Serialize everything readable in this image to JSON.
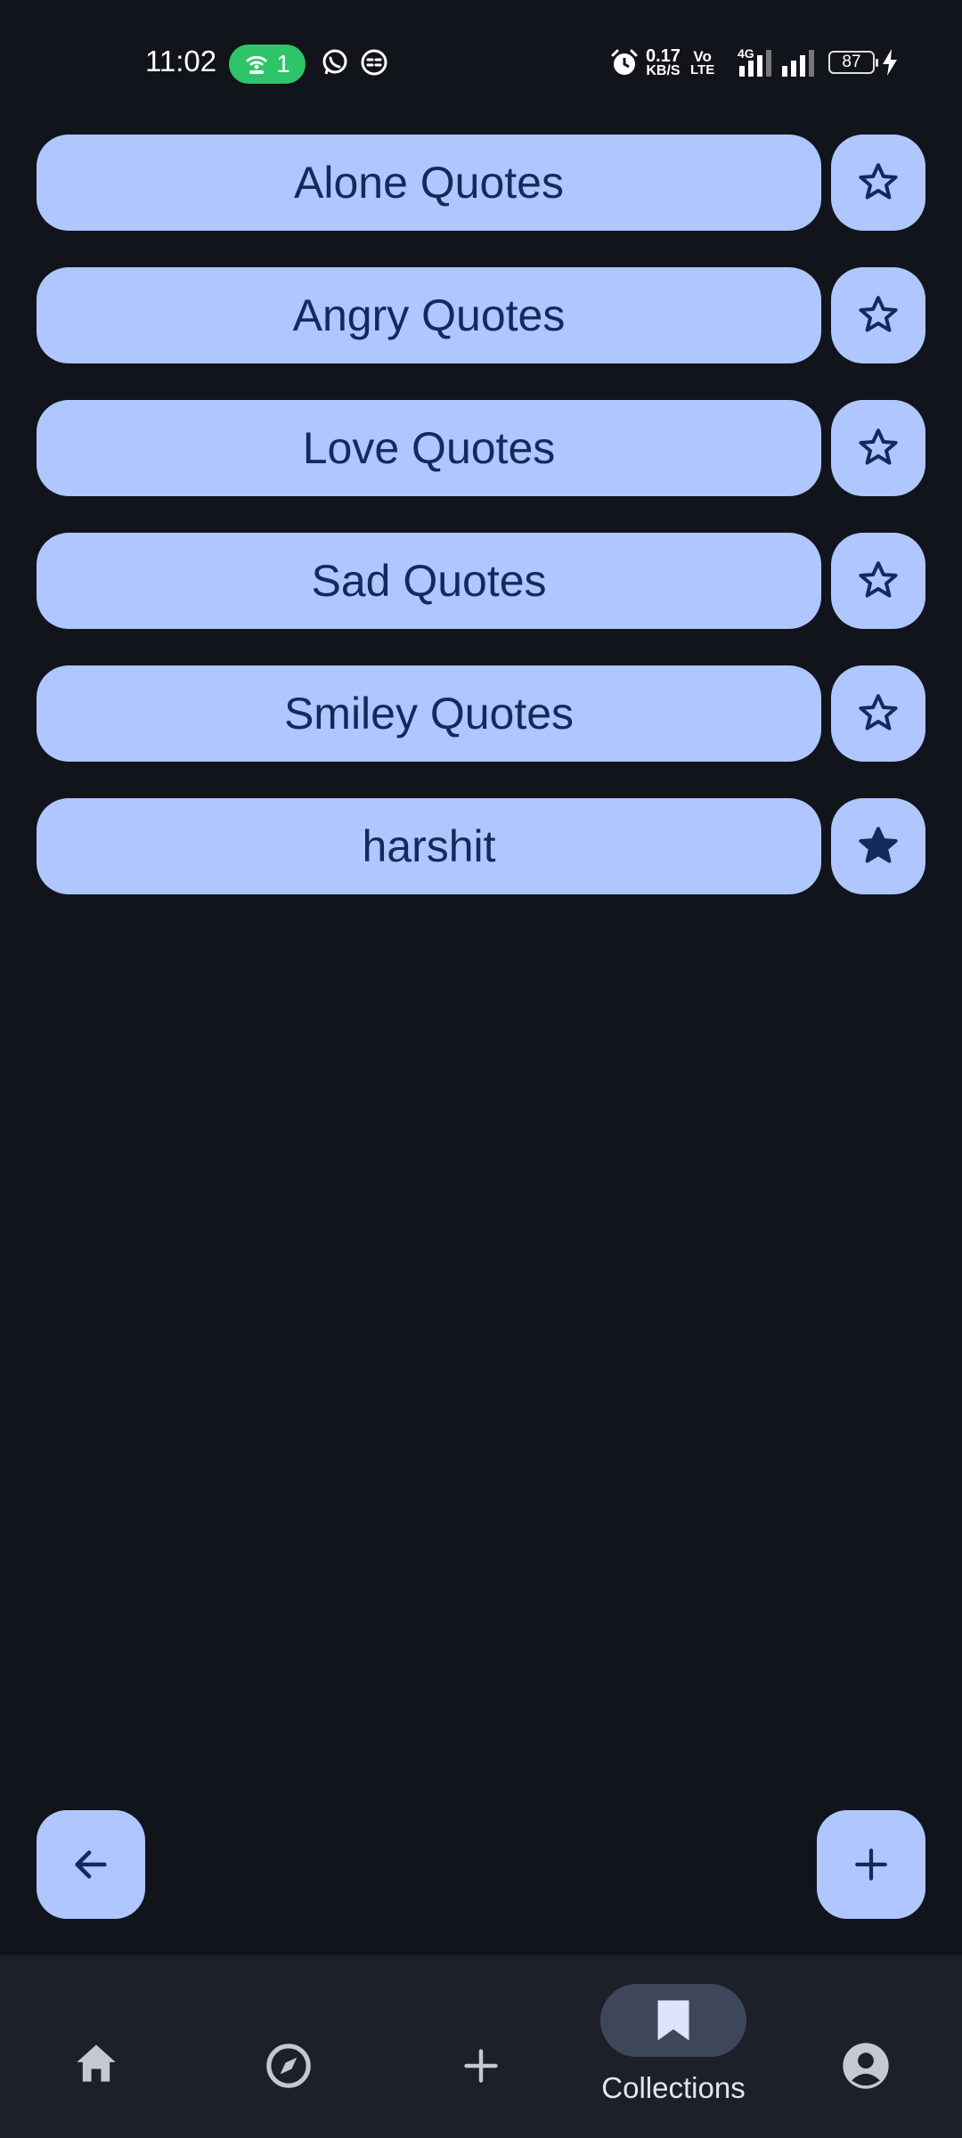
{
  "status_bar": {
    "time": "11:02",
    "hotspot_count": "1",
    "net_speed_value": "0.17",
    "net_speed_unit": "KB/S",
    "volte_top": "Vo",
    "volte_bottom": "LTE",
    "network_type": "4G",
    "battery": "87"
  },
  "collections": [
    {
      "label": "Alone Quotes",
      "starred": false
    },
    {
      "label": "Angry Quotes",
      "starred": false
    },
    {
      "label": "Love Quotes",
      "starred": false
    },
    {
      "label": "Sad Quotes",
      "starred": false
    },
    {
      "label": "Smiley Quotes",
      "starred": false
    },
    {
      "label": "harshit",
      "starred": true
    }
  ],
  "fabs": {
    "back_icon": "arrow-back-icon",
    "add_icon": "plus-icon"
  },
  "bottom_nav": {
    "items": [
      {
        "icon": "home-icon",
        "label": ""
      },
      {
        "icon": "compass-icon",
        "label": ""
      },
      {
        "icon": "plus-icon",
        "label": ""
      },
      {
        "icon": "bookmark-icon",
        "label": "Collections",
        "active": true
      },
      {
        "icon": "account-icon",
        "label": ""
      }
    ]
  },
  "colors": {
    "background": "#11141b",
    "button": "#afc6ff",
    "button_text": "#132b5c",
    "nav_background": "#1d2029",
    "nav_indicator": "#3e4759",
    "hotspot": "#2fc46a"
  }
}
